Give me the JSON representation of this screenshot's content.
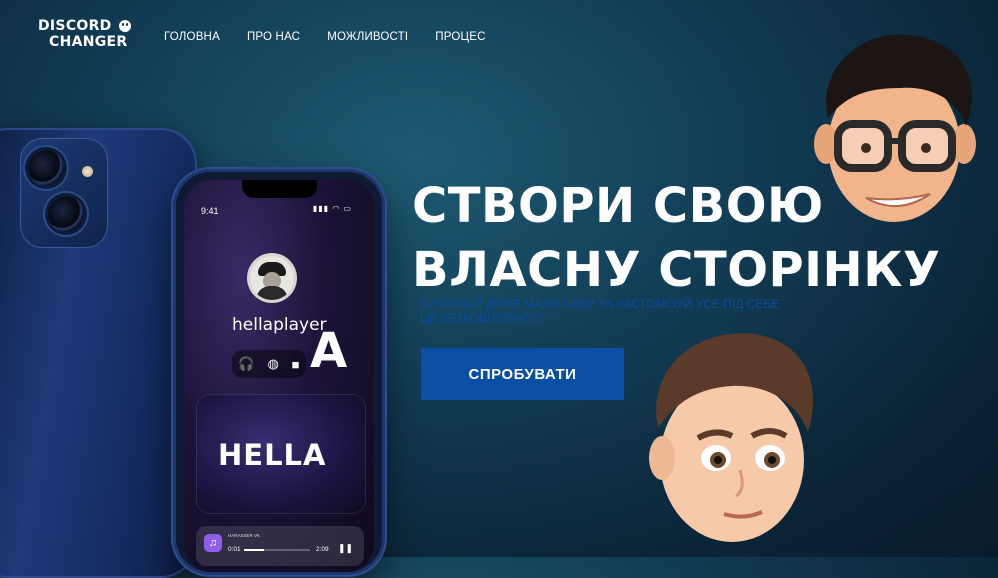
{
  "brand": {
    "line1": "DISCORD",
    "line2": "CHANGER"
  },
  "nav": {
    "items": [
      "ГОЛОВНА",
      "ПРО НАС",
      "МОЖЛИВОСТІ",
      "ПРОЦЕС"
    ]
  },
  "hero": {
    "title_line1": "СТВОРИ СВОЮ",
    "title_line2": "ВЛАСНУ СТОРІНКУ",
    "subtitle_line1": "ВИТРАЧАЙ ДУЖЕ МАЛО ЧАСУ ТА КАСТОМІЗУЙ УСЕ ПІД СЕБЕ",
    "subtitle_line2": "ЦЕ БЕЗКОШТОВНО!!!",
    "cta_label": "СПРОБУВАТИ"
  },
  "phone": {
    "status_time": "9:41",
    "status_icons": "▮▮▮ ◠ ▭",
    "username": "hellaplayer",
    "big_letter": "A",
    "card_text": "HELLA",
    "player": {
      "track": "HARASSER VK",
      "time_start": "0:01",
      "time_end": "2:09",
      "progress": 0.3
    }
  },
  "colors": {
    "accent": "#0a4fa3",
    "subtitle": "#0b4a9f",
    "background": "#123e57"
  }
}
